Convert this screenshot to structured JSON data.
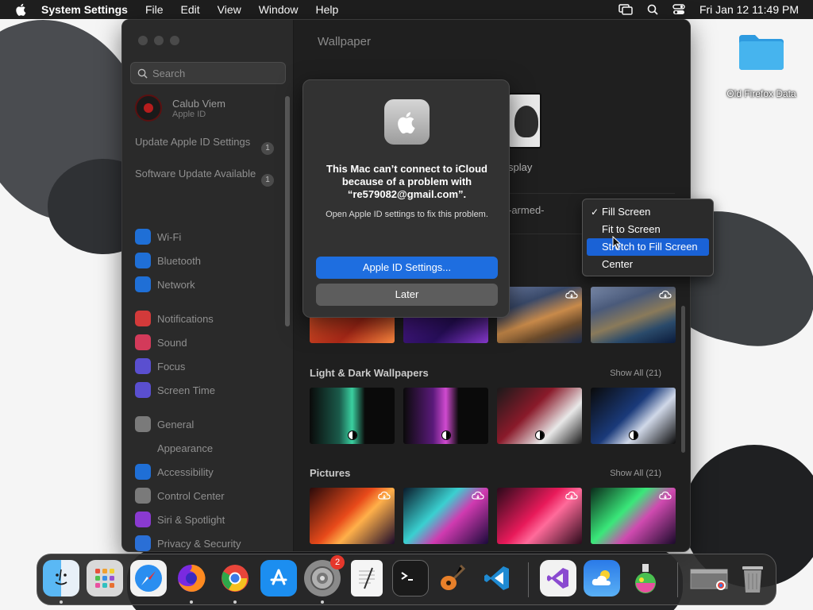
{
  "menubar": {
    "app_name": "System Settings",
    "menus": [
      "File",
      "Edit",
      "View",
      "Window",
      "Help"
    ],
    "clock": "Fri Jan 12  11:49 PM"
  },
  "desktop": {
    "folder_label": "Old Firefox Data"
  },
  "window": {
    "search_placeholder": "Search",
    "account": {
      "name": "Calub Viem",
      "subtitle": "Apple ID"
    },
    "notices": [
      {
        "label": "Update Apple ID Settings",
        "badge": "1"
      },
      {
        "label": "Software Update Available",
        "badge": "1"
      }
    ],
    "sidebar_items": [
      {
        "label": "Wi-Fi",
        "icon": "wifi-icon",
        "color": "#1f6fd6"
      },
      {
        "label": "Bluetooth",
        "icon": "bluetooth-icon",
        "color": "#1f6fd6"
      },
      {
        "label": "Network",
        "icon": "globe-icon",
        "color": "#1f6fd6"
      },
      {
        "label": "Notifications",
        "icon": "bell-icon",
        "color": "#d33a3a"
      },
      {
        "label": "Sound",
        "icon": "speaker-icon",
        "color": "#d33a5a"
      },
      {
        "label": "Focus",
        "icon": "moon-icon",
        "color": "#5a4fd0"
      },
      {
        "label": "Screen Time",
        "icon": "hourglass-icon",
        "color": "#5a4fd0"
      },
      {
        "label": "General",
        "icon": "gear-icon",
        "color": "#7a7a7a"
      },
      {
        "label": "Appearance",
        "icon": "appearance-icon",
        "color": "#2a2a2a"
      },
      {
        "label": "Accessibility",
        "icon": "accessibility-icon",
        "color": "#1f6fd6"
      },
      {
        "label": "Control Center",
        "icon": "control-center-icon",
        "color": "#7a7a7a"
      },
      {
        "label": "Siri & Spotlight",
        "icon": "siri-icon",
        "color": "#8a3ad0"
      },
      {
        "label": "Privacy & Security",
        "icon": "hand-icon",
        "color": "#2a6fd6"
      }
    ],
    "content": {
      "title": "Wallpaper",
      "display_label": "splay",
      "filename": "-armed-",
      "sections": [
        {
          "title": "Light & Dark Wallpapers",
          "show_all": "Show All (21)"
        },
        {
          "title": "Pictures",
          "show_all": "Show All (21)"
        }
      ]
    }
  },
  "dropdown": {
    "options": [
      "Fill Screen",
      "Fit to Screen",
      "Stretch to Fill Screen",
      "Center"
    ],
    "checked": "Fill Screen",
    "highlighted": "Stretch to Fill Screen",
    "check_mark": "✓"
  },
  "alert": {
    "headline": "This Mac can’t connect to iCloud because of a problem with “re579082@gmail.com”.",
    "body": "Open Apple ID settings to fix this problem.",
    "primary_button": "Apple ID Settings...",
    "secondary_button": "Later"
  },
  "dock": {
    "settings_badge": "2",
    "apps": [
      "Finder",
      "Launchpad",
      "Safari",
      "Firefox",
      "Chrome",
      "App Store",
      "System Settings",
      "TextEdit",
      "Terminal",
      "GarageBand",
      "Visual Studio Code",
      "Visual Studio",
      "Weather",
      "Color Picker",
      "Downloads",
      "Trash"
    ]
  },
  "colors": {
    "accent": "#1e6ee0",
    "selection": "#1a62d6",
    "badge": "#e5372b",
    "folder": "#2fa9e8"
  }
}
